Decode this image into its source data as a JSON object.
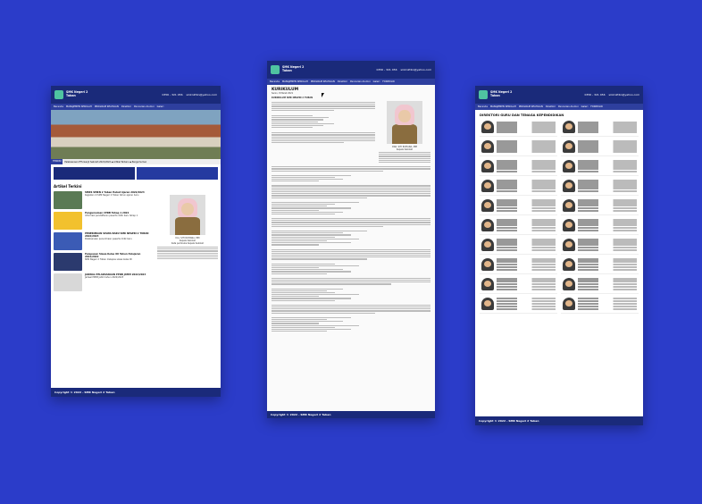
{
  "site": {
    "name_line1": "SMK Negeri 2",
    "name_line2": "Tuban",
    "phone": "0356 - 321 456",
    "email": "smkn2tbn@yahoo.com"
  },
  "nav": [
    "Beranda",
    "MANAJEMEN SEKOLAH",
    "PROGRAM KEAHLIAN",
    "Direktori",
    "Pencarian Alumni",
    "Galeri",
    "FORMULIR"
  ],
  "page1": {
    "ticker_label": "TERKINI",
    "ticker_text": "Pelaksanaan PTS Ganjil Sekolah 2021/2022 ▪ Artikel Terbaru ▪ Pengumuman",
    "sec_title": "Artikel Terkini",
    "articles": [
      {
        "title": "SMKS SMKN 2 Tuban Hebat Ajaran 2022/2023",
        "body": "Kegiatan di SMK Negeri 2 Tuban tahun ajaran baru"
      },
      {
        "title": "Pengumuman CPDB Tahap 1 2022",
        "body": "Informasi pendaftaran peserta didik baru tahap 1"
      },
      {
        "title": "PENERIMAAN SISWA BARU SMK NEGERI 2 TUBAN 2022/2023",
        "body": "Pelaksanaan penerimaan peserta didik baru"
      },
      {
        "title": "Pelepasan Siswa Kelas XII Tahun Pelajaran 2021/2022",
        "body": "SMK Negeri 2 Tuban melepas siswa kelas XII"
      },
      {
        "title": "JADWAL PELAKSANAAN PPDB JATIM 2022/2023",
        "body": "Jadwal PPDB Jatim tahun 2022/2023"
      }
    ],
    "head_name": "Dra. SITI ROHANA, MM",
    "head_role": "Kepala Sekolah",
    "head_caption": "Kata pembuka Kepala Sekolah"
  },
  "page2": {
    "title": "KURIKULUM",
    "date": "Senin, 8 Maret 2021",
    "sec1": "KURIKULUM SMK NEGERI 2 TUBAN",
    "head_name": "DRA. SITI ROHANA, MM",
    "head_role": "Kepala Sekolah"
  },
  "page3": {
    "title": "DIREKTORI GURU DAN TENAGA KEPENDIDIKAN"
  },
  "footer": {
    "copyright": "Copyright © 2022 - SMK Negeri 2 Tuban"
  }
}
